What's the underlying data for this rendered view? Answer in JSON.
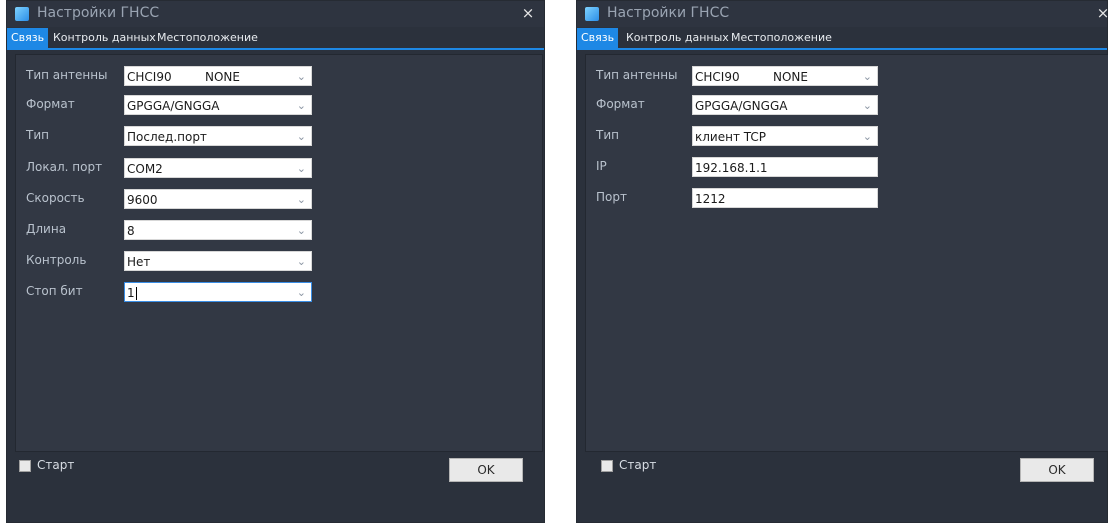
{
  "colors": {
    "window_bg": "#2b313c",
    "panel_bg": "#323844",
    "accent": "#1e88e5"
  },
  "windows": [
    {
      "title": "Настройки ГНСС",
      "close_label": "×",
      "tabs": [
        "Связь",
        "Контроль данных",
        "Местоположение"
      ],
      "active_tab": "Связь",
      "rows": [
        {
          "label": "Тип антенны",
          "value": "CHCI90",
          "extra": "NONE",
          "dropdown": true
        },
        {
          "label": "Формат",
          "value": "GPGGA/GNGGA",
          "dropdown": true
        },
        {
          "label": "Тип",
          "value": "Послед.порт",
          "dropdown": true
        },
        {
          "label": "Локал. порт",
          "value": "COM2",
          "dropdown": true
        },
        {
          "label": "Скорость",
          "value": "9600",
          "dropdown": true
        },
        {
          "label": "Длина",
          "value": "8",
          "dropdown": true
        },
        {
          "label": "Контроль",
          "value": "Нет",
          "dropdown": true
        },
        {
          "label": "Стоп бит",
          "value": "1",
          "dropdown": true,
          "focused": true
        }
      ],
      "start_label": "Старт",
      "ok_label": "OK"
    },
    {
      "title": "Настройки ГНСС",
      "close_label": "×",
      "tabs": [
        "Связь",
        "Контроль данных",
        "Местоположение"
      ],
      "active_tab": "Связь",
      "rows": [
        {
          "label": "Тип антенны",
          "value": "CHCI90",
          "extra": "NONE",
          "dropdown": true
        },
        {
          "label": "Формат",
          "value": "GPGGA/GNGGA",
          "dropdown": true
        },
        {
          "label": "Тип",
          "value": "клиент TCP",
          "dropdown": true
        },
        {
          "label": "IP",
          "value": "192.168.1.1",
          "dropdown": false
        },
        {
          "label": "Порт",
          "value": "1212",
          "dropdown": false
        }
      ],
      "start_label": "Старт",
      "ok_label": "OK"
    }
  ]
}
